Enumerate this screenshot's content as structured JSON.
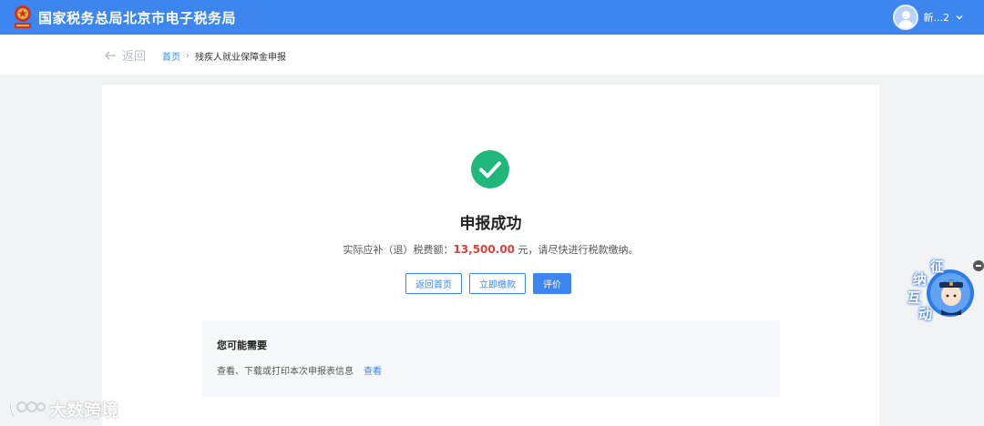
{
  "header": {
    "site_title": "国家税务总局北京市电子税务局",
    "user_name": "新...2",
    "icons": [
      "tax-emblem-icon",
      "avatar-icon",
      "chevron-down-icon"
    ]
  },
  "breadcrumb": {
    "back_label": "返回",
    "home": "首页",
    "separator": "›",
    "current": "残疾人就业保障金申报"
  },
  "result": {
    "title": "申报成功",
    "desc_prefix": "实际应补（退）税费额：",
    "amount": "13,500.00",
    "desc_suffix": " 元，请尽快进行税款缴纳。",
    "status_icon": "check-circle-icon",
    "status_color": "#1fb87a"
  },
  "actions": {
    "home_btn": "返回首页",
    "pay_btn": "立即缴款",
    "rate_btn": "评价"
  },
  "maybe_need": {
    "title": "您可能需要",
    "text": "查看、下载或打印本次申报表信息",
    "link": "查看"
  },
  "widget": {
    "chars": [
      "征",
      "纳",
      "互",
      "动"
    ]
  },
  "watermark": {
    "text": "大数跨境"
  },
  "colors": {
    "brand": "#3d86f0",
    "amount": "#e0413a"
  }
}
